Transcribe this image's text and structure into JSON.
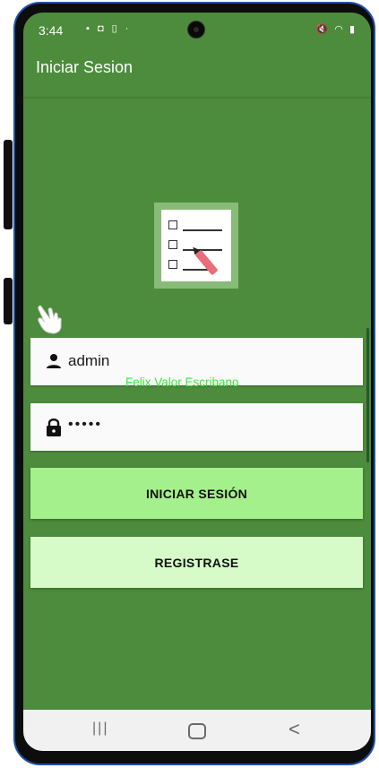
{
  "status": {
    "time": "3:44",
    "left_icons": "▪ ◘ ▯ ·",
    "right_icons": "🔇 ◠ ▮"
  },
  "appbar": {
    "title": "Iniciar Sesion"
  },
  "form": {
    "username_value": "admin",
    "password_value": "•••••",
    "overlay_text": "Felix Valor Escribano"
  },
  "buttons": {
    "login_label": "INICIAR SESIÓN",
    "register_label": "REGISTRASE"
  },
  "navbar": {
    "recent_glyph": "|||",
    "back_glyph": "<"
  },
  "colors": {
    "background": "#4c8c3c",
    "login_button": "#a4f08c",
    "register_button": "#d6fbc8",
    "overlay_text": "#3ee83e"
  }
}
